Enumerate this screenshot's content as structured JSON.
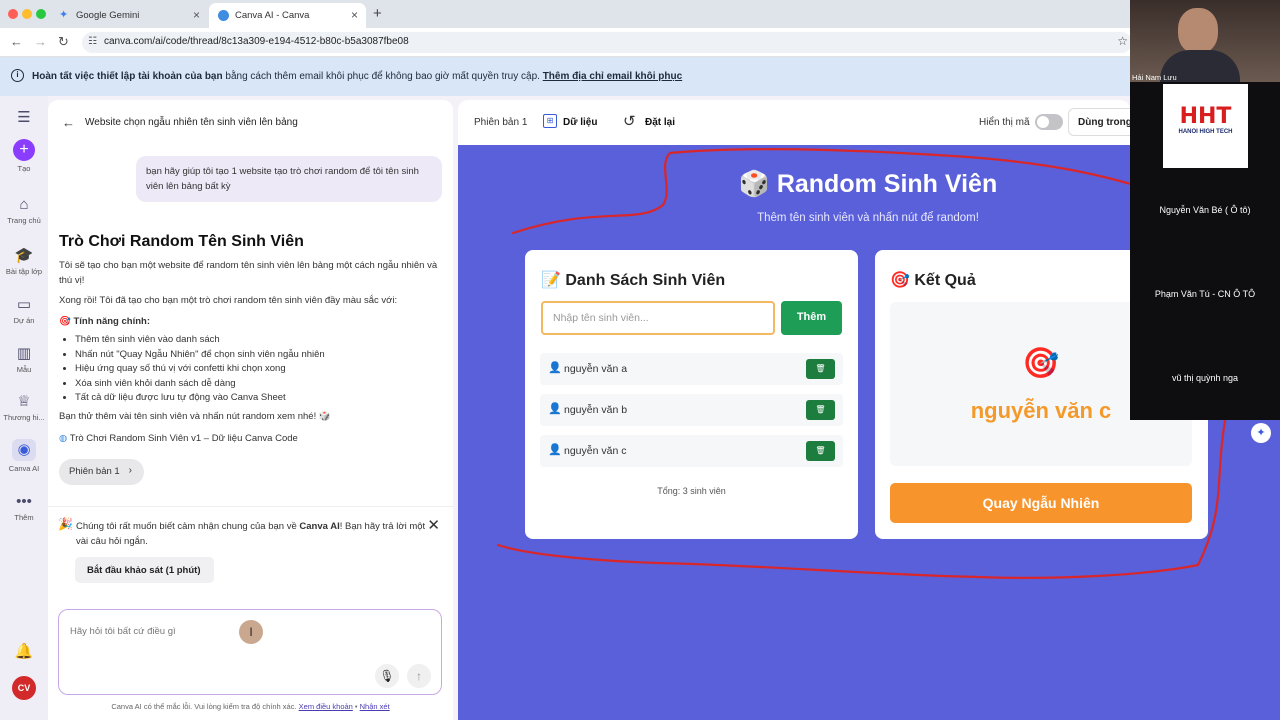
{
  "browser": {
    "tabs": [
      {
        "title": "Google Gemini"
      },
      {
        "title": "Canva AI - Canva"
      }
    ],
    "new_tab": "+",
    "url": "canva.com/ai/code/thread/8c13a309-e194-4512-b80c-b5a3087fbe08"
  },
  "notice": {
    "bold": "Hoàn tất việc thiết lập tài khoản của bạn",
    "text": " bằng cách thêm email khôi phục để không bao giờ mất quyền truy cập.",
    "link": "Thêm địa chỉ email khôi phục"
  },
  "rail": {
    "create": "Tạo",
    "home": "Trang chủ",
    "classwork": "Bài tập lớp",
    "projects": "Dự án",
    "templates": "Mẫu",
    "brand": "Thương hi...",
    "canva_ai": "Canva AI",
    "more": "Thêm",
    "avatar": "CV"
  },
  "chat": {
    "thread_title": "Website chọn ngẫu nhiên tên sinh viên lên bảng",
    "user_msg": "bạn hãy giúp tôi tạo 1 website tạo trò chơi random để tôi tên sinh viên lên bảng bất kỳ",
    "heading": "Trò Chơi Random Tên Sinh Viên",
    "p1": "Tôi sẽ tạo cho bạn một website để random tên sinh viên lên bảng một cách ngẫu nhiên và thú vị!",
    "p2": "Xong rồi! Tôi đã tạo cho bạn một trò chơi random tên sinh viên đầy màu sắc với:",
    "features_title": "Tính năng chính:",
    "features": [
      "Thêm tên sinh viên vào danh sách",
      "Nhấn nút \"Quay Ngẫu Nhiên\" để chọn sinh viên ngẫu nhiên",
      "Hiệu ứng quay số thú vị với confetti khi chọn xong",
      "Xóa sinh viên khỏi danh sách dễ dàng",
      "Tất cả dữ liệu được lưu tự động vào Canva Sheet"
    ],
    "p3": "Bạn thử thêm vài tên sinh viên và nhấn nút random xem nhé! 🎲",
    "data_link": "Trò Chơi Random Sinh Viên v1 – Dữ liệu Canva Code",
    "version_chip": "Phiên bản 1",
    "survey_text_a": "Chúng tôi rất muốn biết cảm nhận chung của bạn về ",
    "survey_bold": "Canva AI",
    "survey_text_b": "! Bạn hãy trả lời một vài câu hỏi ngắn.",
    "survey_button": "Bắt đầu khảo sát (1 phút)",
    "input_placeholder": "Hãy hỏi tôi bất cứ điều gì",
    "footer_text": "Canva AI có thể mắc lỗi. Vui lòng kiểm tra độ chính xác.",
    "footer_link1": "Xem điều khoản",
    "footer_sep": " • ",
    "footer_link2": "Nhận xét"
  },
  "toolbar": {
    "version": "Phiên bản 1",
    "data": "Dữ liệu",
    "reset": "Đặt lại",
    "show_code": "Hiển thị mã",
    "use_in": "Dùng trong"
  },
  "app": {
    "title": "🎲 Random Sinh Viên",
    "subtitle": "Thêm tên sinh viên và nhấn nút để random!",
    "list_title": "📝 Danh Sách Sinh Viên",
    "name_placeholder": "Nhập tên sinh viên...",
    "add_button": "Thêm",
    "students": [
      "nguyễn văn a",
      "nguyễn văn b",
      "nguyễn văn c"
    ],
    "delete_label": "🗑",
    "total": "Tổng: 3 sinh viên",
    "result_title": "🎯 Kết Quả",
    "result_name": "nguyễn văn c",
    "spin_button": "Quay Ngẫu Nhiên"
  },
  "webcam": {
    "participants": [
      "Hải Nam Lưu",
      "Nguyễn Văn Bé ( Ô tô)",
      "Phạm Văn Tú - CN Ô TÔ",
      "vũ thị quỳnh nga"
    ],
    "logo": "HHT",
    "logo_sub": "HANOI HIGH TECH"
  },
  "colors": {
    "preview_bg": "#5a60d9",
    "accent_green": "#1d7d3e",
    "orange": "#f7942b",
    "annotation_red": "#d8262a"
  }
}
